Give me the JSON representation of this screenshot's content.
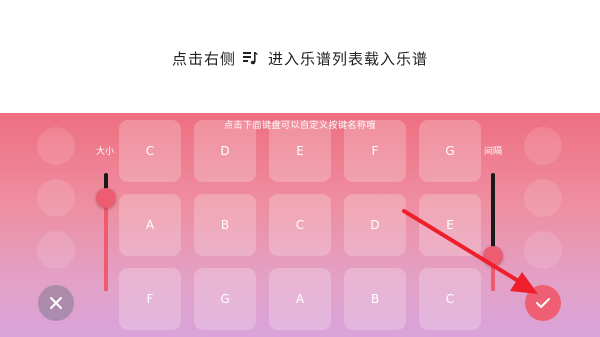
{
  "banner": {
    "text_before_icon": "点击右侧",
    "text_after_icon": "进入乐谱列表载入乐谱",
    "icon": "score-list-icon"
  },
  "panel": {
    "hint": "点击下面键盘可以自定义按键名称哦",
    "size_label": "大小",
    "gap_label": "间隔",
    "size_slider_value": 0.79,
    "gap_slider_value": 0.3,
    "keys": [
      [
        "C",
        "D",
        "E",
        "F",
        "G"
      ],
      [
        "A",
        "B",
        "C",
        "D",
        "E"
      ],
      [
        "F",
        "G",
        "A",
        "B",
        "C"
      ]
    ],
    "close_icon": "close-icon",
    "confirm_icon": "check-icon",
    "colors": {
      "slider_accent": "#ef5a6f",
      "confirm_button": "#ef5f74",
      "arrow": "#ee1f2a"
    }
  }
}
